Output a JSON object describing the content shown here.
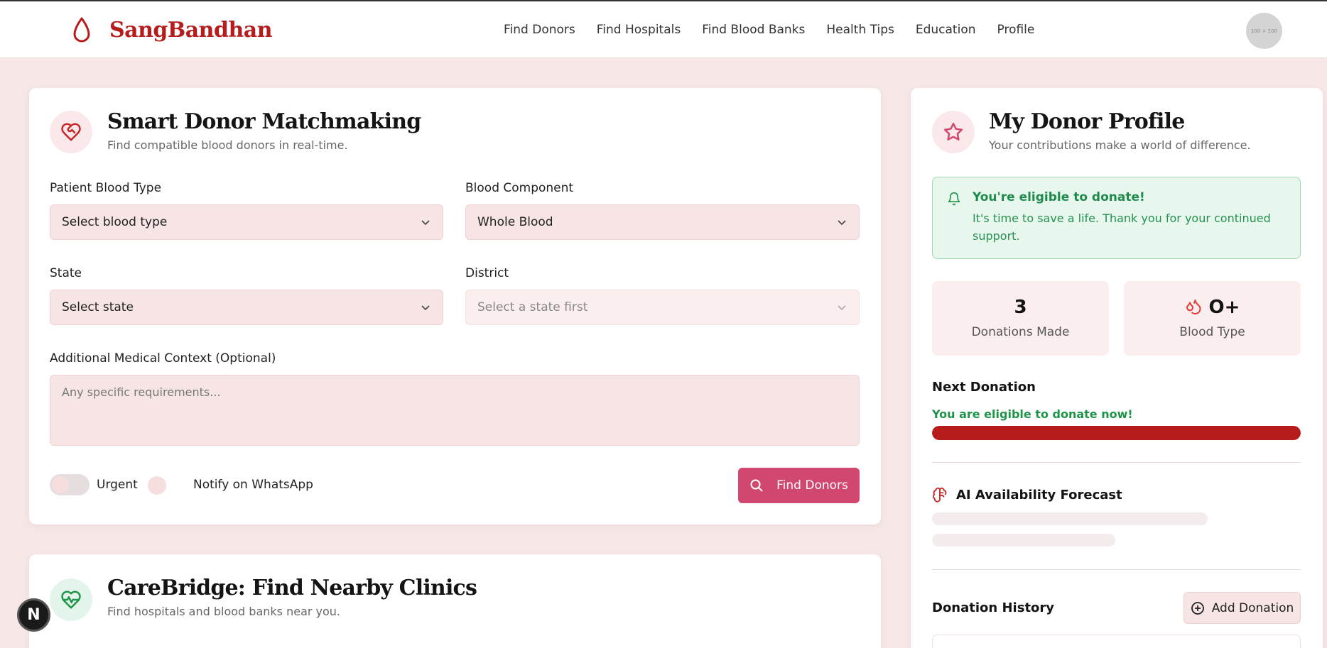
{
  "brand": {
    "name": "SangBandhan",
    "logo_icon": "blood-drop-icon",
    "color": "#b71c1c"
  },
  "nav": [
    "Find Donors",
    "Find Hospitals",
    "Find Blood Banks",
    "Health Tips",
    "Education",
    "Profile"
  ],
  "avatar": {
    "placeholder": "100 × 100"
  },
  "matchmaking": {
    "title": "Smart Donor Matchmaking",
    "subtitle": "Find compatible blood donors in real-time.",
    "icon": "heart-handshake-icon",
    "blood_type": {
      "label": "Patient Blood Type",
      "value": "Select blood type"
    },
    "component": {
      "label": "Blood Component",
      "value": "Whole Blood"
    },
    "state": {
      "label": "State",
      "value": "Select state"
    },
    "district": {
      "label": "District",
      "value": "Select a state first"
    },
    "context": {
      "label": "Additional Medical Context (Optional)",
      "placeholder": "Any specific requirements..."
    },
    "urgent_label": "Urgent",
    "whatsapp_label": "Notify on WhatsApp",
    "find_button": "Find Donors",
    "accent": "#d2476f"
  },
  "clinics": {
    "title": "CareBridge: Find Nearby Clinics",
    "subtitle": "Find hospitals and blood banks near you.",
    "icon": "heart-pulse-icon"
  },
  "profile": {
    "title": "My Donor Profile",
    "subtitle": "Your contributions make a world of difference.",
    "icon": "star-icon",
    "alert": {
      "title": "You're eligible to donate!",
      "body": "It's time to save a life. Thank you for your continued support."
    },
    "stats": [
      {
        "value": "3",
        "label": "Donations Made"
      },
      {
        "value": "O+",
        "label": "Blood Type",
        "icon": "blood-drops-icon"
      }
    ],
    "next_donation": {
      "heading": "Next Donation",
      "status": "You are eligible to donate now!",
      "progress_fraction": 1.0
    },
    "forecast": {
      "heading": "AI Availability Forecast",
      "icon": "brain-icon"
    },
    "history": {
      "heading": "Donation History",
      "add_button": "Add Donation"
    }
  },
  "fab": {
    "label": "N"
  }
}
